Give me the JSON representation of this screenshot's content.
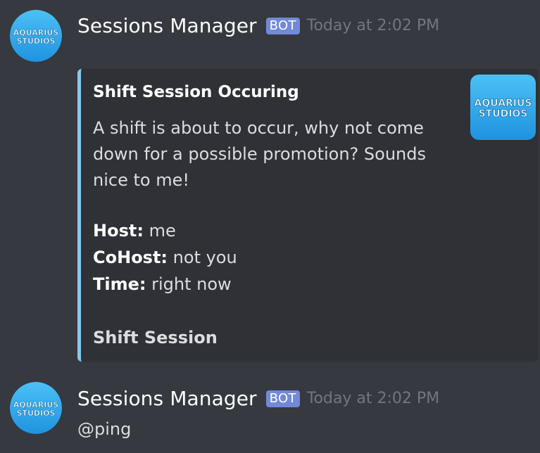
{
  "colors": {
    "background": "#36393f",
    "embed_background": "#2f3136",
    "embed_accent": "#87c8f0",
    "bot_tag": "#7289da",
    "avatar_bg": "#2ea6ea"
  },
  "messages": [
    {
      "author": "Sessions Manager",
      "bot_tag": "BOT",
      "timestamp": "Today at 2:02 PM",
      "avatar": {
        "icon": "aquarius-studios-logo-icon",
        "line1": "AQUARIUS",
        "line2": "STUDIOS"
      },
      "embed": {
        "title": "Shift Session Occuring",
        "description": "A shift is about to occur, why not come down for a possible promotion? Sounds nice to me!",
        "fields": [
          {
            "name": "Host:",
            "value": "me"
          },
          {
            "name": "CoHost:",
            "value": "not you"
          },
          {
            "name": "Time:",
            "value": "right now"
          }
        ],
        "footer": "Shift Session",
        "thumbnail": {
          "icon": "aquarius-studios-logo-icon",
          "line1": "AQUARIUS",
          "line2": "STUDIOS"
        }
      }
    },
    {
      "author": "Sessions Manager",
      "bot_tag": "BOT",
      "timestamp": "Today at 2:02 PM",
      "avatar": {
        "icon": "aquarius-studios-logo-icon",
        "line1": "AQUARIUS",
        "line2": "STUDIOS"
      },
      "content": "@ping"
    }
  ]
}
